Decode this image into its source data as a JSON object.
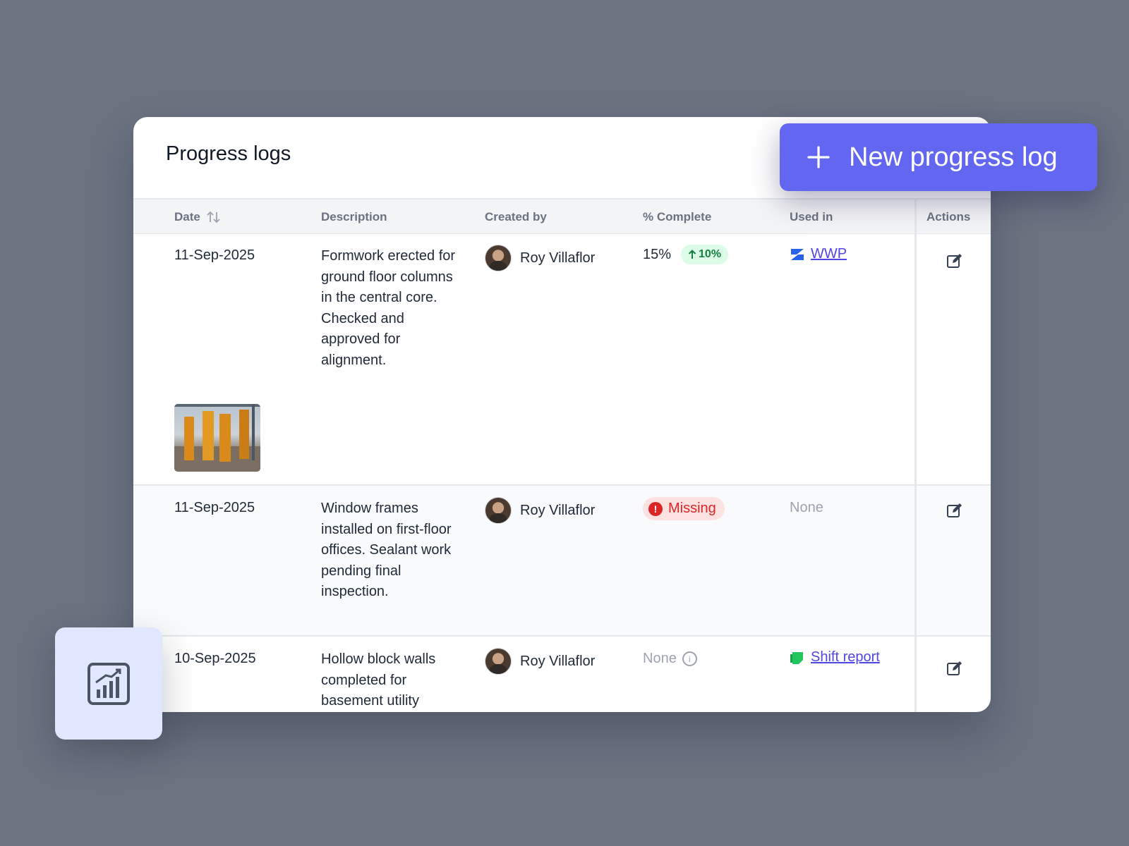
{
  "card": {
    "title": "Progress logs"
  },
  "header_button": {
    "label": "New progress log"
  },
  "table": {
    "columns": {
      "date": "Date",
      "description": "Description",
      "created_by": "Created by",
      "complete": "% Complete",
      "used_in": "Used in",
      "actions": "Actions"
    },
    "rows": [
      {
        "date": "11-Sep-2025",
        "description": "Formwork erected for ground floor columns in the central core. Checked and approved for alignment.",
        "created_by": "Roy Villaflor",
        "complete": "15%",
        "trend": "10%",
        "used_in": "WWP"
      },
      {
        "date": "11-Sep-2025",
        "description": "Window frames installed on first-floor offices. Sealant work pending final inspection.",
        "created_by": "Roy Villaflor",
        "complete_status": "Missing",
        "used_in": "None"
      },
      {
        "date": "10-Sep-2025",
        "description": "Hollow block walls completed for basement utility",
        "created_by": "Roy Villaflor",
        "complete": "None",
        "used_in": "Shift report"
      }
    ]
  },
  "colors": {
    "accent": "#6366f1",
    "background": "#6b7280",
    "success_bg": "#dcfce7",
    "success_text": "#15803d",
    "danger_bg": "#fee2e2",
    "danger_text": "#dc2626",
    "link": "#4f46e5"
  },
  "icons": [
    "plus-icon",
    "sort-icon",
    "trend-up-icon",
    "wwp-icon",
    "shift-report-icon",
    "alert-icon",
    "info-icon",
    "edit-icon",
    "chart-icon"
  ]
}
